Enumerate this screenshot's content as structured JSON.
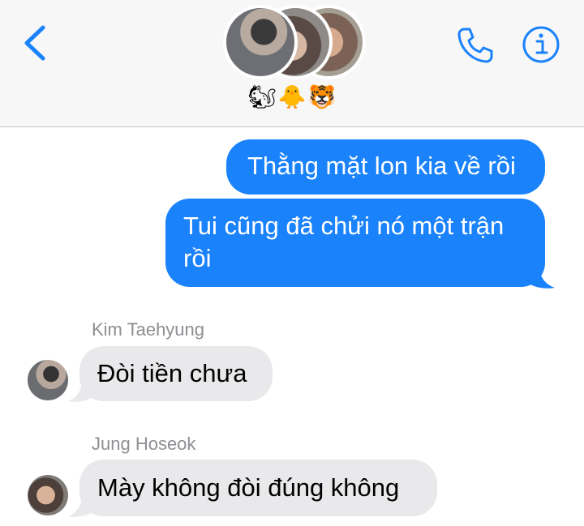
{
  "header": {
    "back_icon": "chevron-left-icon",
    "call_icon": "phone-icon",
    "info_icon": "info-icon",
    "group_emojis": [
      "🐿",
      "🐥",
      "🐯"
    ],
    "accent_color": "#1a82fb"
  },
  "messages": [
    {
      "direction": "outgoing",
      "text": "Thằng mặt lon kia về rồi"
    },
    {
      "direction": "outgoing",
      "text": "Tui cũng đã chửi nó một trận rồi"
    },
    {
      "direction": "incoming",
      "sender": "Kim Taehyung",
      "text": "Đòi tiền chưa"
    },
    {
      "direction": "incoming",
      "sender": "Jung Hoseok",
      "text": "Mày không đòi đúng không"
    }
  ]
}
